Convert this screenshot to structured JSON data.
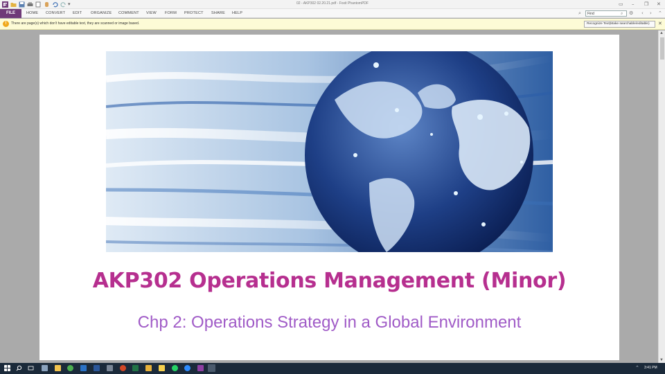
{
  "window": {
    "title": "02 - AKP302 02.20.21.pdf - Foxit PhantomPDF"
  },
  "ribbon": {
    "file_tab": "FILE",
    "tabs": [
      "HOME",
      "CONVERT",
      "EDIT",
      "ORGANIZE",
      "COMMENT",
      "VIEW",
      "FORM",
      "PROTECT",
      "SHARE",
      "HELP"
    ],
    "find_placeholder": "Find"
  },
  "notice": {
    "message": "There are page(s) which don't have editable text, they are scanned or image based.",
    "recognize_button": "Recognize Text(Make searchable/editable)"
  },
  "slide": {
    "image_icon": "globe-network-image",
    "title": "AKP302 Operations Management (Minor)",
    "subtitle": "Chp 2: Operations Strategy in a Global Environment"
  },
  "taskbar": {
    "time": "3:41 PM"
  },
  "colors": {
    "file_tab": "#6f3a78",
    "title": "#b62f8f",
    "subtitle": "#a05bc7",
    "notice_bg": "#fdfbd6",
    "taskbar_bg": "#1b2a3a"
  }
}
